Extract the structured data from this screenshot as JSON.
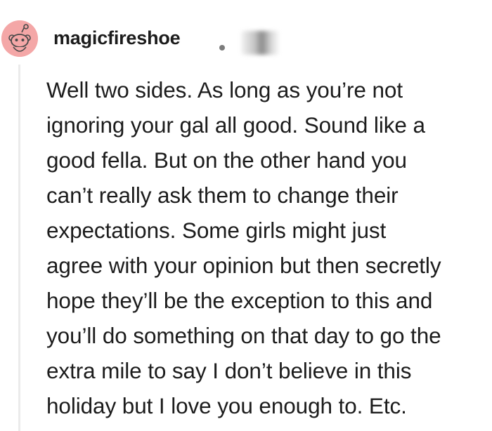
{
  "comment": {
    "author": "magicfireshoe",
    "avatar_icon": "reddit-snoo-avatar-icon",
    "avatar_color": "#f4a7a7",
    "separator": "•",
    "body_lines": [
      "Well two sides. As long as you’re not",
      "ignoring your gal all good. Sound like a",
      "good fella. But on the other hand you",
      "can’t really ask them to change their",
      "expectations. Some girls might just",
      "agree with your opinion but then secretly",
      "hope they’ll be the exception to this and",
      "you’ll do something on that day to go the",
      "extra mile to say I don’t believe in this",
      "holiday but I love you enough to. Etc."
    ]
  }
}
